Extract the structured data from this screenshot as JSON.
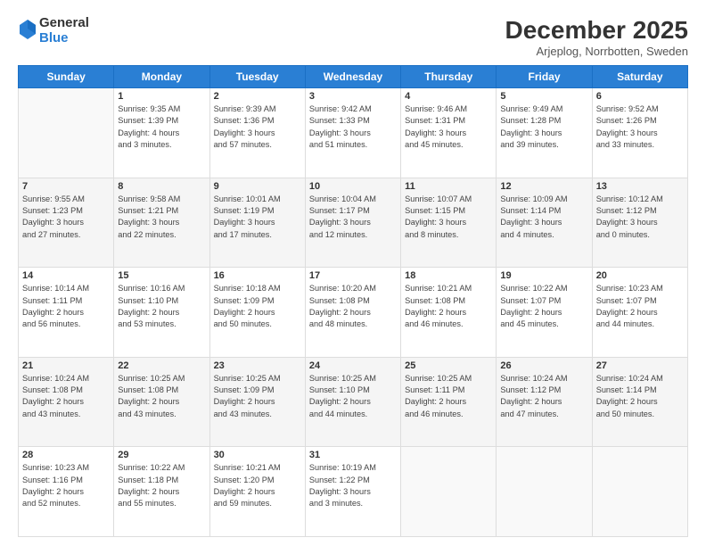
{
  "logo": {
    "general": "General",
    "blue": "Blue"
  },
  "header": {
    "month": "December 2025",
    "location": "Arjeplog, Norrbotten, Sweden"
  },
  "weekdays": [
    "Sunday",
    "Monday",
    "Tuesday",
    "Wednesday",
    "Thursday",
    "Friday",
    "Saturday"
  ],
  "weeks": [
    [
      {
        "num": "",
        "info": ""
      },
      {
        "num": "1",
        "info": "Sunrise: 9:35 AM\nSunset: 1:39 PM\nDaylight: 4 hours\nand 3 minutes."
      },
      {
        "num": "2",
        "info": "Sunrise: 9:39 AM\nSunset: 1:36 PM\nDaylight: 3 hours\nand 57 minutes."
      },
      {
        "num": "3",
        "info": "Sunrise: 9:42 AM\nSunset: 1:33 PM\nDaylight: 3 hours\nand 51 minutes."
      },
      {
        "num": "4",
        "info": "Sunrise: 9:46 AM\nSunset: 1:31 PM\nDaylight: 3 hours\nand 45 minutes."
      },
      {
        "num": "5",
        "info": "Sunrise: 9:49 AM\nSunset: 1:28 PM\nDaylight: 3 hours\nand 39 minutes."
      },
      {
        "num": "6",
        "info": "Sunrise: 9:52 AM\nSunset: 1:26 PM\nDaylight: 3 hours\nand 33 minutes."
      }
    ],
    [
      {
        "num": "7",
        "info": "Sunrise: 9:55 AM\nSunset: 1:23 PM\nDaylight: 3 hours\nand 27 minutes."
      },
      {
        "num": "8",
        "info": "Sunrise: 9:58 AM\nSunset: 1:21 PM\nDaylight: 3 hours\nand 22 minutes."
      },
      {
        "num": "9",
        "info": "Sunrise: 10:01 AM\nSunset: 1:19 PM\nDaylight: 3 hours\nand 17 minutes."
      },
      {
        "num": "10",
        "info": "Sunrise: 10:04 AM\nSunset: 1:17 PM\nDaylight: 3 hours\nand 12 minutes."
      },
      {
        "num": "11",
        "info": "Sunrise: 10:07 AM\nSunset: 1:15 PM\nDaylight: 3 hours\nand 8 minutes."
      },
      {
        "num": "12",
        "info": "Sunrise: 10:09 AM\nSunset: 1:14 PM\nDaylight: 3 hours\nand 4 minutes."
      },
      {
        "num": "13",
        "info": "Sunrise: 10:12 AM\nSunset: 1:12 PM\nDaylight: 3 hours\nand 0 minutes."
      }
    ],
    [
      {
        "num": "14",
        "info": "Sunrise: 10:14 AM\nSunset: 1:11 PM\nDaylight: 2 hours\nand 56 minutes."
      },
      {
        "num": "15",
        "info": "Sunrise: 10:16 AM\nSunset: 1:10 PM\nDaylight: 2 hours\nand 53 minutes."
      },
      {
        "num": "16",
        "info": "Sunrise: 10:18 AM\nSunset: 1:09 PM\nDaylight: 2 hours\nand 50 minutes."
      },
      {
        "num": "17",
        "info": "Sunrise: 10:20 AM\nSunset: 1:08 PM\nDaylight: 2 hours\nand 48 minutes."
      },
      {
        "num": "18",
        "info": "Sunrise: 10:21 AM\nSunset: 1:08 PM\nDaylight: 2 hours\nand 46 minutes."
      },
      {
        "num": "19",
        "info": "Sunrise: 10:22 AM\nSunset: 1:07 PM\nDaylight: 2 hours\nand 45 minutes."
      },
      {
        "num": "20",
        "info": "Sunrise: 10:23 AM\nSunset: 1:07 PM\nDaylight: 2 hours\nand 44 minutes."
      }
    ],
    [
      {
        "num": "21",
        "info": "Sunrise: 10:24 AM\nSunset: 1:08 PM\nDaylight: 2 hours\nand 43 minutes."
      },
      {
        "num": "22",
        "info": "Sunrise: 10:25 AM\nSunset: 1:08 PM\nDaylight: 2 hours\nand 43 minutes."
      },
      {
        "num": "23",
        "info": "Sunrise: 10:25 AM\nSunset: 1:09 PM\nDaylight: 2 hours\nand 43 minutes."
      },
      {
        "num": "24",
        "info": "Sunrise: 10:25 AM\nSunset: 1:10 PM\nDaylight: 2 hours\nand 44 minutes."
      },
      {
        "num": "25",
        "info": "Sunrise: 10:25 AM\nSunset: 1:11 PM\nDaylight: 2 hours\nand 46 minutes."
      },
      {
        "num": "26",
        "info": "Sunrise: 10:24 AM\nSunset: 1:12 PM\nDaylight: 2 hours\nand 47 minutes."
      },
      {
        "num": "27",
        "info": "Sunrise: 10:24 AM\nSunset: 1:14 PM\nDaylight: 2 hours\nand 50 minutes."
      }
    ],
    [
      {
        "num": "28",
        "info": "Sunrise: 10:23 AM\nSunset: 1:16 PM\nDaylight: 2 hours\nand 52 minutes."
      },
      {
        "num": "29",
        "info": "Sunrise: 10:22 AM\nSunset: 1:18 PM\nDaylight: 2 hours\nand 55 minutes."
      },
      {
        "num": "30",
        "info": "Sunrise: 10:21 AM\nSunset: 1:20 PM\nDaylight: 2 hours\nand 59 minutes."
      },
      {
        "num": "31",
        "info": "Sunrise: 10:19 AM\nSunset: 1:22 PM\nDaylight: 3 hours\nand 3 minutes."
      },
      {
        "num": "",
        "info": ""
      },
      {
        "num": "",
        "info": ""
      },
      {
        "num": "",
        "info": ""
      }
    ]
  ]
}
